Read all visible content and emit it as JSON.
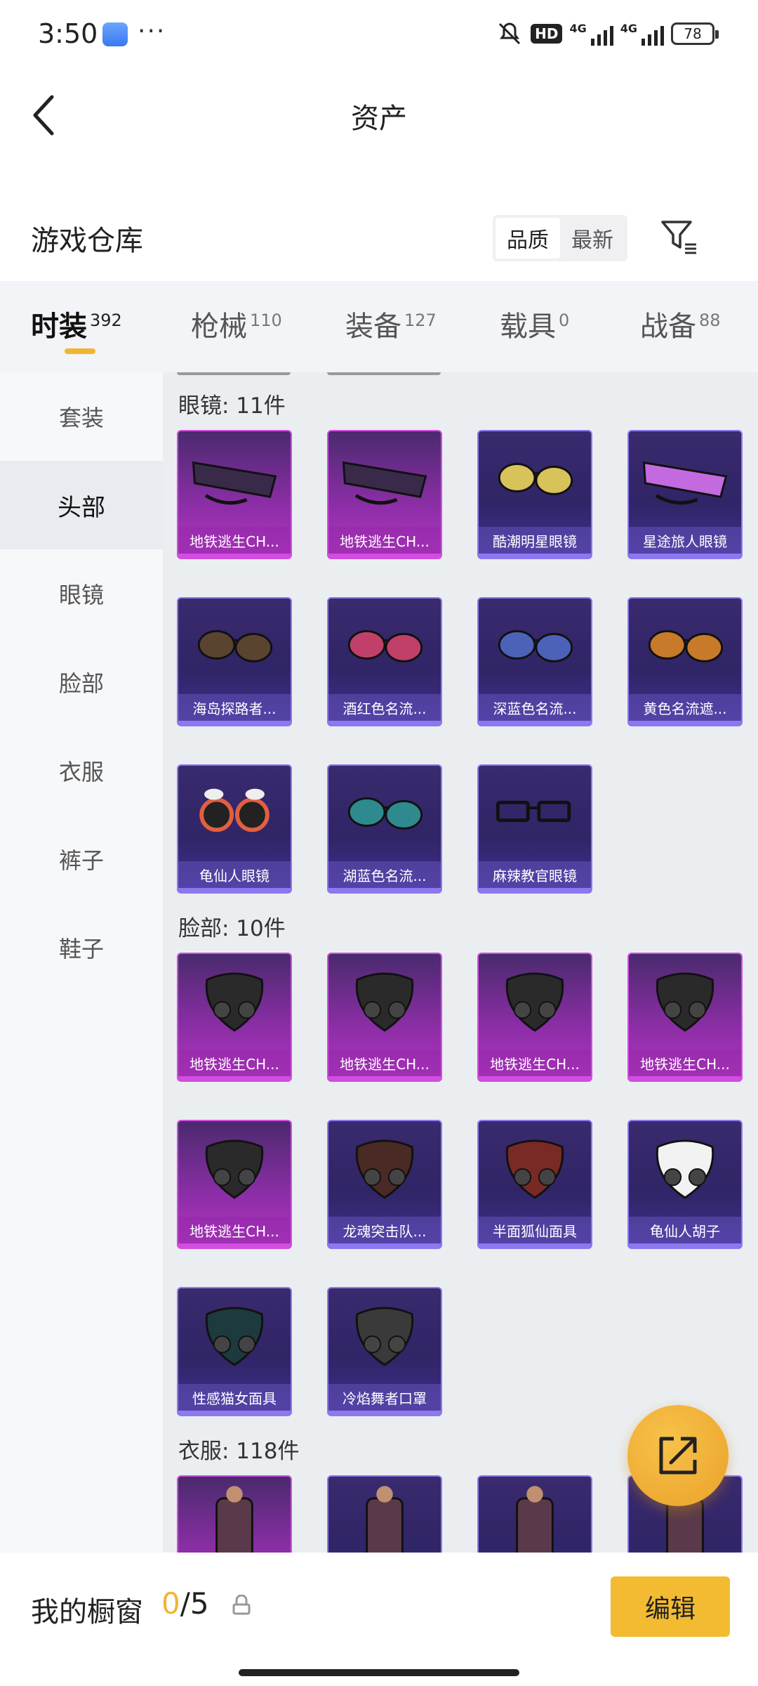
{
  "status_bar": {
    "time": "3:50",
    "dots": "···",
    "hd": "HD",
    "sig1": "4G",
    "sig2": "4G",
    "battery": "78"
  },
  "header": {
    "title": "资产"
  },
  "warehouse": {
    "title": "游戏仓库",
    "sort_options": [
      "品质",
      "最新"
    ],
    "selected_sort": "品质"
  },
  "category_tabs": [
    {
      "label": "时装",
      "count": "392",
      "active": true
    },
    {
      "label": "枪械",
      "count": "110"
    },
    {
      "label": "装备",
      "count": "127"
    },
    {
      "label": "载具",
      "count": "0"
    },
    {
      "label": "战备",
      "count": "88"
    }
  ],
  "sidebar": [
    {
      "label": "套装"
    },
    {
      "label": "头部",
      "active": true
    },
    {
      "label": "眼镜"
    },
    {
      "label": "脸部"
    },
    {
      "label": "衣服"
    },
    {
      "label": "裤子"
    },
    {
      "label": "鞋子"
    }
  ],
  "sections": [
    {
      "title": "眼镜: 11件",
      "items": [
        {
          "name": "地铁逃生CH...",
          "rarity": "pink",
          "icon": "visor-glasses"
        },
        {
          "name": "地铁逃生CH...",
          "rarity": "pink",
          "icon": "tactical-glasses"
        },
        {
          "name": "酷潮明星眼镜",
          "rarity": "purple",
          "icon": "gold-aviator"
        },
        {
          "name": "星途旅人眼镜",
          "rarity": "purple",
          "icon": "purple-visor"
        },
        {
          "name": "海岛探路者...",
          "rarity": "purple",
          "icon": "brown-sunglasses"
        },
        {
          "name": "酒红色名流...",
          "rarity": "purple",
          "icon": "red-aviator"
        },
        {
          "name": "深蓝色名流...",
          "rarity": "purple",
          "icon": "blue-aviator"
        },
        {
          "name": "黄色名流遮...",
          "rarity": "purple",
          "icon": "orange-aviator"
        },
        {
          "name": "龟仙人眼镜",
          "rarity": "purple",
          "icon": "round-glasses"
        },
        {
          "name": "湖蓝色名流...",
          "rarity": "purple",
          "icon": "teal-aviator"
        },
        {
          "name": "麻辣教官眼镜",
          "rarity": "purple",
          "icon": "black-frame-glasses"
        }
      ]
    },
    {
      "title": "脸部: 10件",
      "items": [
        {
          "name": "地铁逃生CH...",
          "rarity": "pink",
          "icon": "gas-mask"
        },
        {
          "name": "地铁逃生CH...",
          "rarity": "pink",
          "icon": "face-mask"
        },
        {
          "name": "地铁逃生CH...",
          "rarity": "pink",
          "icon": "filter-pieces"
        },
        {
          "name": "地铁逃生CH...",
          "rarity": "pink",
          "icon": "respirator"
        },
        {
          "name": "地铁逃生CH...",
          "rarity": "pink",
          "icon": "studded-mask"
        },
        {
          "name": "龙魂突击队...",
          "rarity": "purple",
          "icon": "assault-mask"
        },
        {
          "name": "半面狐仙面具",
          "rarity": "purple",
          "icon": "fox-mask"
        },
        {
          "name": "龟仙人胡子",
          "rarity": "purple",
          "icon": "beard"
        },
        {
          "name": "性感猫女面具",
          "rarity": "purple",
          "icon": "cat-mask"
        },
        {
          "name": "冷焰舞者口罩",
          "rarity": "purple",
          "icon": "flame-mask"
        }
      ]
    },
    {
      "title": "衣服: 118件",
      "items": [
        {
          "name": "",
          "rarity": "pink",
          "icon": "outfit-1"
        },
        {
          "name": "",
          "rarity": "purple",
          "icon": "outfit-2"
        },
        {
          "name": "",
          "rarity": "purple",
          "icon": "outfit-3"
        },
        {
          "name": "",
          "rarity": "purple",
          "icon": "outfit-4"
        }
      ]
    }
  ],
  "bottom_bar": {
    "label": "我的橱窗",
    "current": "0",
    "total": "/5",
    "edit_label": "编辑"
  },
  "colors": {
    "accent": "#f3bb31",
    "rarity_pink": "#d24ee0",
    "rarity_purple": "#8e78f0"
  }
}
